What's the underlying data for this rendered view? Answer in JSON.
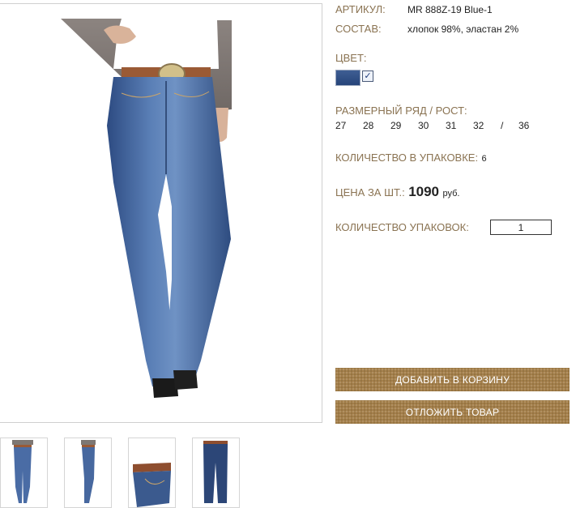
{
  "product": {
    "sku_label": "АРТИКУЛ:",
    "sku_value": "MR 888Z-19 Blue-1",
    "composition_label": "СОСТАВ:",
    "composition_value": "хлопок 98%, эластан 2%",
    "color_label": "ЦВЕТ:",
    "color_swatch": "#2f4e86",
    "color_checked": "✓",
    "sizes_label": "РАЗМЕРНЫЙ РЯД / РОСТ:",
    "sizes": [
      "27",
      "28",
      "29",
      "30",
      "31",
      "32",
      "/",
      "36"
    ],
    "pack_qty_label": "КОЛИЧЕСТВО В УПАКОВКЕ:",
    "pack_qty_value": "6",
    "price_label": "ЦЕНА ЗА ШТ.:",
    "price_value": "1090",
    "price_currency": "руб.",
    "packs_label": "КОЛИЧЕСТВО УПАКОВОК:",
    "packs_value": "1"
  },
  "actions": {
    "add_to_cart": "ДОБАВИТЬ В КОРЗИНУ",
    "postpone": "ОТЛОЖИТЬ ТОВАР"
  },
  "colors": {
    "label": "#8a7352",
    "button": "#a47f4a",
    "denim": "#3f5f96"
  },
  "thumbnails": [
    "front-view",
    "side-view",
    "waistband-detail",
    "flat-lay"
  ]
}
